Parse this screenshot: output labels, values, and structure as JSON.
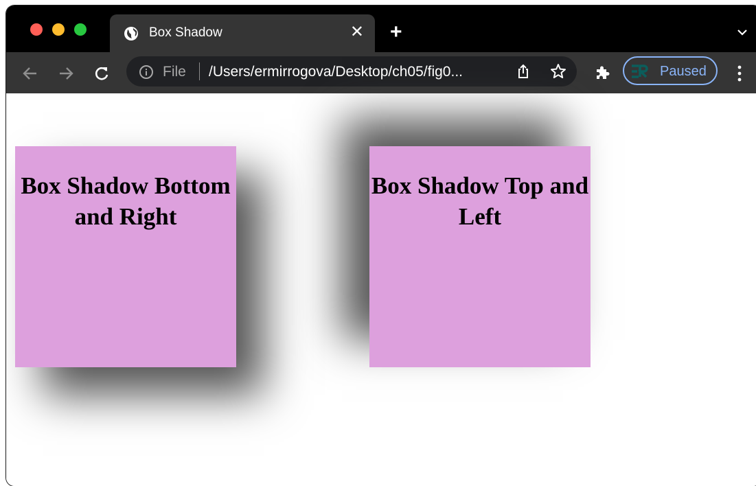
{
  "tab": {
    "title": "Box Shadow",
    "close_label": "✕"
  },
  "new_tab_label": "+",
  "omnibox": {
    "scheme": "File",
    "url": "/Users/ermirrogova/Desktop/ch05/fig0..."
  },
  "profile": {
    "status": "Paused"
  },
  "colors": {
    "box_fill": "#dda0dd",
    "accent": "#8ab4f8"
  },
  "boxes": [
    {
      "text": "Box Shadow Bottom and Right"
    },
    {
      "text": "Box Shadow Top and Left"
    }
  ]
}
